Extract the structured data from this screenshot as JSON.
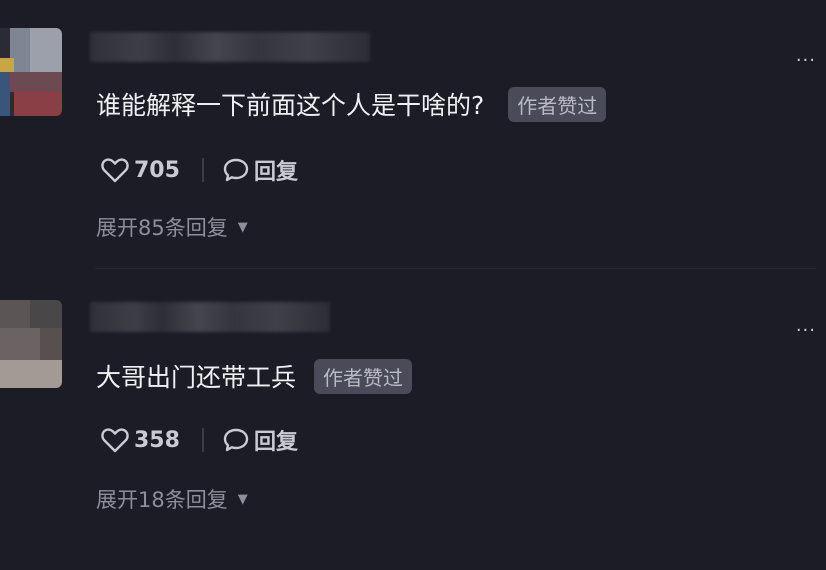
{
  "comments": [
    {
      "text": "谁能解释一下前面这个人是干啥的?",
      "badge": "作者赞过",
      "likes": "705",
      "reply_label": "回复",
      "expand_label": "展开85条回复",
      "more_icon": "more-dots-icon"
    },
    {
      "text": "大哥出门还带工兵",
      "badge": "作者赞过",
      "likes": "358",
      "reply_label": "回复",
      "expand_label": "展开18条回复",
      "more_icon": "more-dots-icon"
    }
  ],
  "icons": {
    "like": "heart-icon",
    "reply": "speech-bubble-icon",
    "expand": "caret-down-icon"
  },
  "colors": {
    "background": "#1b1c26",
    "badge_bg": "#4a4b58",
    "muted_text": "#8d8e9b"
  }
}
